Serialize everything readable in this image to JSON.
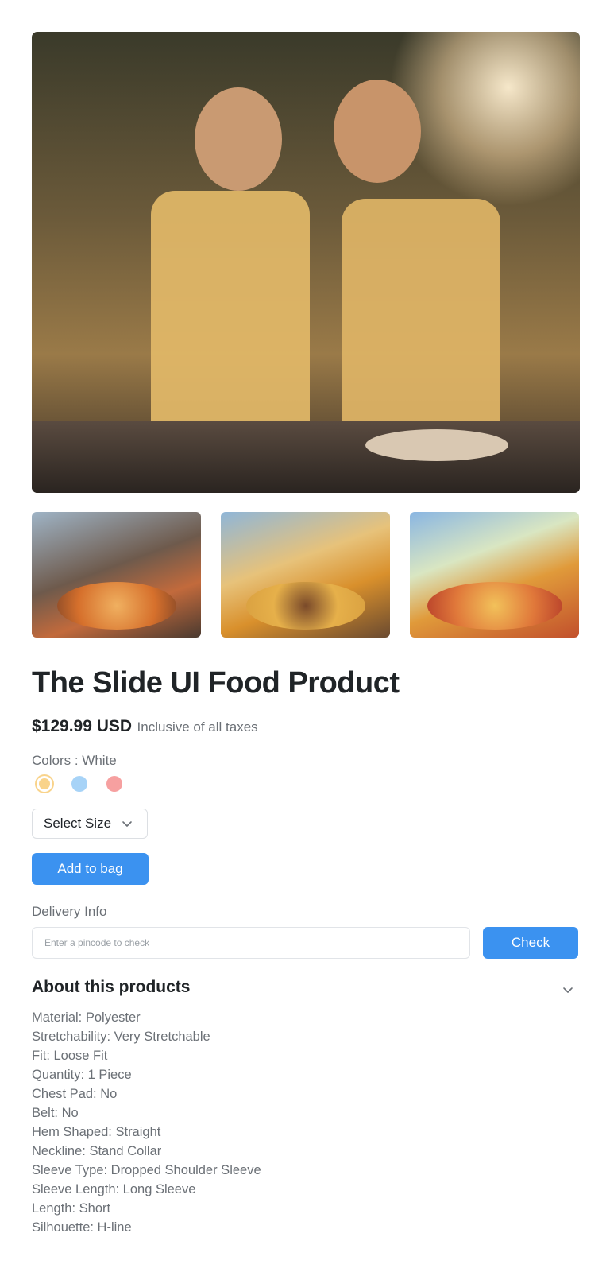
{
  "product": {
    "title": "The Slide UI Food Product",
    "price": "$129.99 USD",
    "tax_note": "Inclusive of all taxes"
  },
  "colors": {
    "label": "Colors : White",
    "swatches": [
      "#f9d38a",
      "#a7d3f7",
      "#f6a0a0"
    ]
  },
  "size": {
    "label": "Select Size"
  },
  "cart": {
    "add_label": "Add to bag"
  },
  "delivery": {
    "label": "Delivery Info",
    "placeholder": "Enter a pincode to check",
    "check_label": "Check"
  },
  "about": {
    "title": "About this products",
    "specs": [
      "Material: Polyester",
      "Stretchability: Very Stretchable",
      "Fit: Loose Fit",
      "Quantity: 1 Piece",
      "Chest Pad: No",
      "Belt: No",
      "Hem Shaped: Straight",
      "Neckline: Stand Collar",
      "Sleeve Type: Dropped Shoulder Sleeve",
      "Sleeve Length: Long Sleeve",
      "Length: Short",
      "Silhouette: H-line"
    ]
  },
  "theme": {
    "accent": "#3b92f0"
  }
}
